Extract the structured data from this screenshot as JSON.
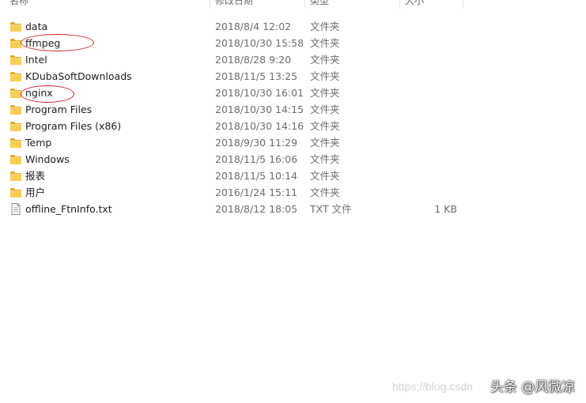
{
  "columns": {
    "name": "名称",
    "modified": "修改日期",
    "type": "类型",
    "size": "大小"
  },
  "files": [
    {
      "name": "data",
      "date": "2018/8/4 12:02",
      "type": "文件夹",
      "size": "",
      "icon": "folder-icon"
    },
    {
      "name": "ffmpeg",
      "date": "2018/10/30 15:58",
      "type": "文件夹",
      "size": "",
      "icon": "folder-icon"
    },
    {
      "name": "Intel",
      "date": "2018/8/28 9:20",
      "type": "文件夹",
      "size": "",
      "icon": "folder-icon"
    },
    {
      "name": "KDubaSoftDownloads",
      "date": "2018/11/5 13:25",
      "type": "文件夹",
      "size": "",
      "icon": "folder-icon"
    },
    {
      "name": "nginx",
      "date": "2018/10/30 16:01",
      "type": "文件夹",
      "size": "",
      "icon": "folder-icon"
    },
    {
      "name": "Program Files",
      "date": "2018/10/30 14:15",
      "type": "文件夹",
      "size": "",
      "icon": "folder-icon"
    },
    {
      "name": "Program Files (x86)",
      "date": "2018/10/30 14:16",
      "type": "文件夹",
      "size": "",
      "icon": "folder-icon"
    },
    {
      "name": "Temp",
      "date": "2018/9/30 11:29",
      "type": "文件夹",
      "size": "",
      "icon": "folder-icon"
    },
    {
      "name": "Windows",
      "date": "2018/11/5 16:06",
      "type": "文件夹",
      "size": "",
      "icon": "folder-icon"
    },
    {
      "name": "报表",
      "date": "2018/11/5 10:14",
      "type": "文件夹",
      "size": "",
      "icon": "folder-icon"
    },
    {
      "name": "用户",
      "date": "2016/1/24 15:11",
      "type": "文件夹",
      "size": "",
      "icon": "folder-icon"
    },
    {
      "name": "offline_FtnInfo.txt",
      "date": "2018/8/12 18:05",
      "type": "TXT 文件",
      "size": "1 KB",
      "icon": "text-file-icon"
    }
  ],
  "annotations": [
    "ffmpeg",
    "nginx"
  ],
  "annotation_color": "#d02020",
  "watermark": "https://blog.csdn",
  "credit": "头条 @风微凉"
}
